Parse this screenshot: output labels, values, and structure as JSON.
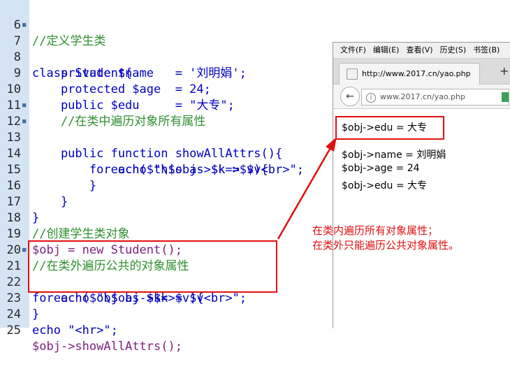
{
  "code": {
    "lines": [
      {
        "num": "6",
        "fold": "",
        "text": "//定义学生类"
      },
      {
        "num": "7",
        "fold": "■",
        "text": "class Student{"
      },
      {
        "num": "8",
        "fold": "",
        "text": "    private $name   = '刘明娟';"
      },
      {
        "num": "9",
        "fold": "",
        "text": "    protected $age  = 24;"
      },
      {
        "num": "10",
        "fold": "",
        "text": "    public $edu     = \"大专\";"
      },
      {
        "num": "11",
        "fold": "",
        "text": "    //在类中遍历对象所有属性"
      },
      {
        "num": "12",
        "fold": "■",
        "text": "    public function showAllAttrs(){"
      },
      {
        "num": "13",
        "fold": "■",
        "text": "        foreach($this as $k=>$v){"
      },
      {
        "num": "14",
        "fold": "",
        "text": "            echo \"\\$obj->$k = $v<br>\";"
      },
      {
        "num": "15",
        "fold": "",
        "text": "        }"
      },
      {
        "num": "16",
        "fold": "",
        "text": "    }"
      },
      {
        "num": "17",
        "fold": "",
        "text": "}"
      },
      {
        "num": "18",
        "fold": "",
        "text": "//创建学生类对象"
      },
      {
        "num": "19",
        "fold": "",
        "text": "$obj = new Student();"
      },
      {
        "num": "20",
        "fold": "",
        "text": "//在类外遍历公共的对象属性"
      },
      {
        "num": "21",
        "fold": "■",
        "text": "foreach($obj as $k=>$v){"
      },
      {
        "num": "22",
        "fold": "",
        "text": "    echo \"\\$obj->$k = $v<br>\";"
      },
      {
        "num": "23",
        "fold": "",
        "text": "}"
      },
      {
        "num": "24",
        "fold": "",
        "text": "echo \"<hr>\";"
      },
      {
        "num": "25",
        "fold": "",
        "text": "$obj->showAllAttrs();"
      }
    ]
  },
  "browser": {
    "menu": [
      "文件(F)",
      "编辑(E)",
      "查看(V)",
      "历史(S)",
      "书签(B)"
    ],
    "tab_title": "http://www.2017.cn/yao.php",
    "new_tab": "+",
    "back": "←",
    "url": "www.2017.cn/yao.php",
    "output_top": "$obj->edu = 大专",
    "output_lines": [
      "$obj->name = 刘明娟",
      "$obj->age = 24",
      "$obj->edu = 大专"
    ]
  },
  "annotation": {
    "line1": "在类内遍历所有对象属性；",
    "line2": "在类外只能遍历公共对象属性。"
  },
  "colors": {
    "highlight": "#e01010",
    "gutter": "#d4e4f5"
  }
}
